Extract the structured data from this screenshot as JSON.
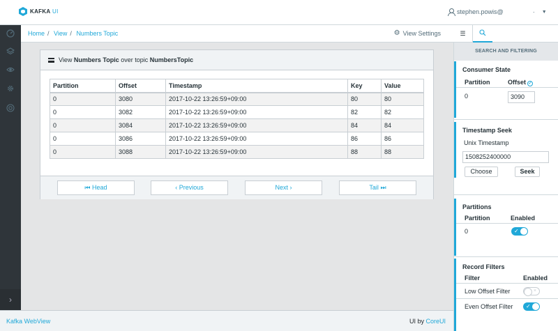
{
  "brand": {
    "name": "KAFKA",
    "suffix": "UI"
  },
  "user": {
    "email": "stephen.powis@",
    "extra": "·"
  },
  "breadcrumb": {
    "home": "Home",
    "view": "View",
    "current": "Numbers Topic",
    "view_settings": "View Settings"
  },
  "card": {
    "title_prefix": "View ",
    "title_view": "Numbers Topic",
    "title_mid": " over topic ",
    "title_topic": "NumbersTopic"
  },
  "table": {
    "headers": [
      "Partition",
      "Offset",
      "Timestamp",
      "Key",
      "Value"
    ],
    "rows": [
      [
        "0",
        "3080",
        "2017-10-22 13:26:59+09:00",
        "80",
        "80"
      ],
      [
        "0",
        "3082",
        "2017-10-22 13:26:59+09:00",
        "82",
        "82"
      ],
      [
        "0",
        "3084",
        "2017-10-22 13:26:59+09:00",
        "84",
        "84"
      ],
      [
        "0",
        "3086",
        "2017-10-22 13:26:59+09:00",
        "86",
        "86"
      ],
      [
        "0",
        "3088",
        "2017-10-22 13:26:59+09:00",
        "88",
        "88"
      ]
    ]
  },
  "pagination": {
    "head": "Head",
    "previous": "Previous",
    "next": "Next",
    "tail": "Tail"
  },
  "aside": {
    "header": "SEARCH AND FILTERING",
    "consumer_state": {
      "title": "Consumer State",
      "partition_label": "Partition",
      "offset_label": "Offset",
      "partition": "0",
      "offset": "3090"
    },
    "timestamp_seek": {
      "title": "Timestamp Seek",
      "label": "Unix Timestamp",
      "value": "1508252400000",
      "choose": "Choose",
      "seek": "Seek"
    },
    "partitions": {
      "title": "Partitions",
      "col_partition": "Partition",
      "col_enabled": "Enabled",
      "partition": "0",
      "enabled": true
    },
    "record_filters": {
      "title": "Record Filters",
      "col_filter": "Filter",
      "col_enabled": "Enabled",
      "filters": [
        {
          "name": "Low Offset Filter",
          "enabled": false
        },
        {
          "name": "Even Offset Filter",
          "enabled": true
        }
      ]
    }
  },
  "footer": {
    "left": "Kafka WebView",
    "right_prefix": "UI by ",
    "right_link": "CoreUI"
  },
  "colors": {
    "accent": "#20a8d8",
    "sidebar": "#2f353a"
  }
}
